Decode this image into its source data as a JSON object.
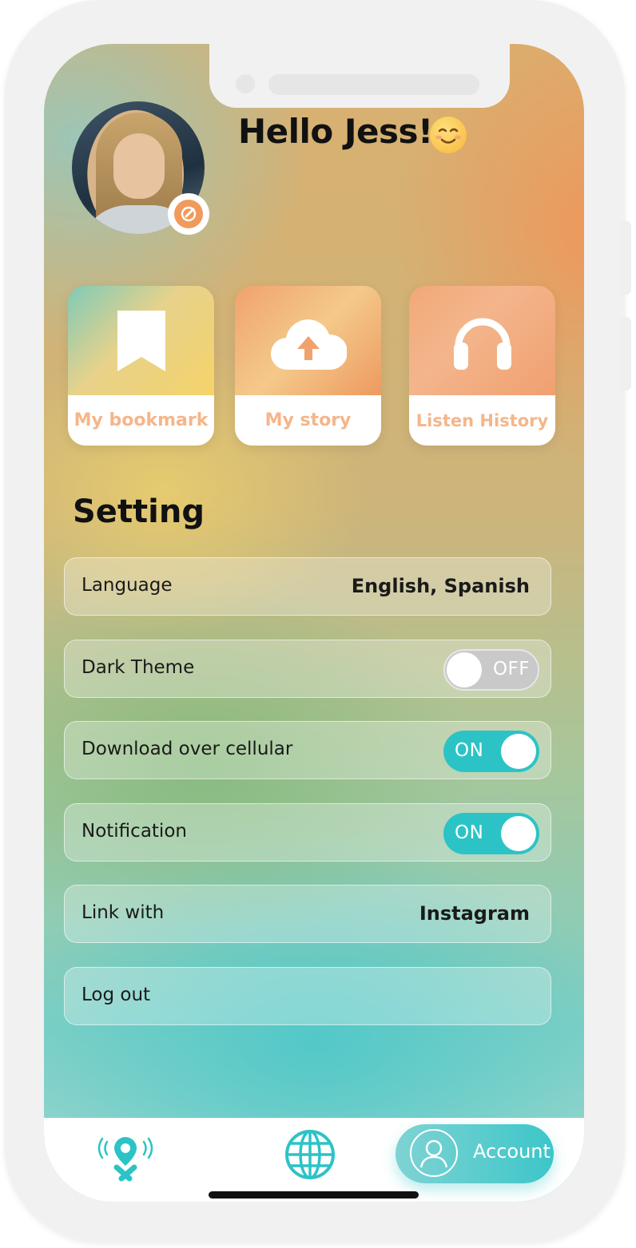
{
  "header": {
    "greeting": "Hello Jess!",
    "greeting_emoji": "smiling-face-emoji"
  },
  "profile": {
    "avatar_icon": "user-photo",
    "edit_icon": "edit-pencil-icon",
    "accent_color": "#f19a5c"
  },
  "shortcuts": [
    {
      "label": "My bookmark",
      "icon": "bookmark-icon"
    },
    {
      "label": "My story",
      "icon": "cloud-upload-icon"
    },
    {
      "label": "Listen History",
      "icon": "headphones-icon"
    }
  ],
  "settings": {
    "title": "Setting",
    "language": {
      "label": "Language",
      "value": "English, Spanish"
    },
    "dark_theme": {
      "label": "Dark Theme",
      "state": "OFF"
    },
    "download_cellular": {
      "label": "Download over cellular",
      "state": "ON"
    },
    "notification": {
      "label": "Notification",
      "state": "ON"
    },
    "link_with": {
      "label": "Link with",
      "value": "Instagram"
    },
    "logout": {
      "label": "Log out"
    }
  },
  "tabbar": {
    "explore_icon": "location-pin-icon",
    "globe_icon": "globe-icon",
    "account_label": "Account",
    "account_icon": "user-icon",
    "active_color": "#2cc3c6"
  }
}
